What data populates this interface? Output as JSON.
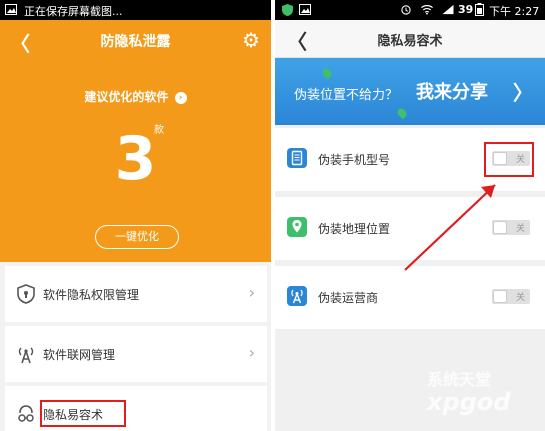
{
  "left": {
    "status": {
      "text": "正在保存屏幕截图..."
    },
    "header": {
      "title": "防隐私泄露",
      "back_label": "〈",
      "settings_icon": "gear-icon"
    },
    "summary": {
      "suggest_label": "建议优化的软件",
      "count": "3",
      "unit": "款",
      "optimize_button": "一键优化"
    },
    "items": [
      {
        "label": "软件隐私权限管理",
        "icon": "shield-icon"
      },
      {
        "label": "软件联网管理",
        "icon": "network-antenna-icon"
      },
      {
        "label": "隐私易容术",
        "icon": "disguise-icon"
      }
    ],
    "colors": {
      "accent": "#f39a1a"
    }
  },
  "right": {
    "status": {
      "signal": "39",
      "time": "下午 2:27"
    },
    "header": {
      "title": "隐私易容术",
      "back_label": "〈"
    },
    "banner": {
      "text_left": "伪装位置不给力？",
      "text_right": "我来分享",
      "chevron": "〉",
      "color": "#2c86d6"
    },
    "settings": [
      {
        "label": "伪装手机型号",
        "toggle_label": "关",
        "enabled": false,
        "icon": "phone-model-icon"
      },
      {
        "label": "伪装地理位置",
        "toggle_label": "关",
        "enabled": false,
        "icon": "location-pin-icon"
      },
      {
        "label": "伪装运营商",
        "toggle_label": "关",
        "enabled": false,
        "icon": "carrier-antenna-icon"
      }
    ]
  },
  "annotation": {
    "color": "#e01e1e"
  },
  "watermark": {
    "line1": "系统天堂",
    "line2": "xpgod"
  }
}
